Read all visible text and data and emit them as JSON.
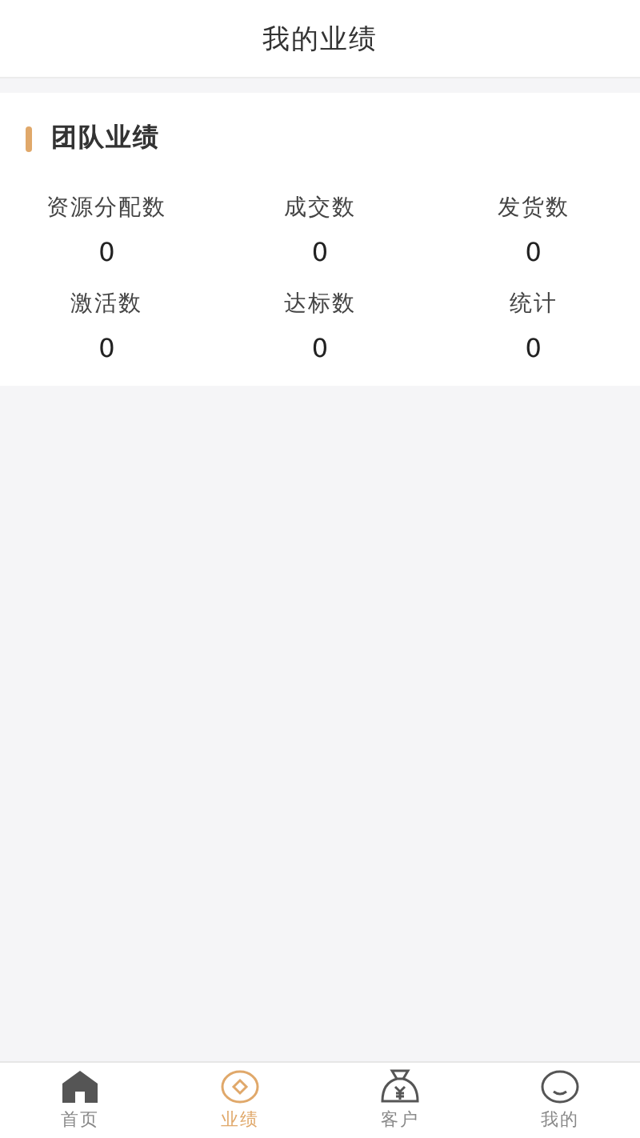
{
  "header": {
    "title": "我的业绩"
  },
  "section": {
    "title": "团队业绩"
  },
  "stats": [
    {
      "label": "资源分配数",
      "value": "0"
    },
    {
      "label": "成交数",
      "value": "0"
    },
    {
      "label": "发货数",
      "value": "0"
    },
    {
      "label": "激活数",
      "value": "0"
    },
    {
      "label": "达标数",
      "value": "0"
    },
    {
      "label": "统计",
      "value": "0"
    }
  ],
  "tab_bar": [
    {
      "label": "首页",
      "kind": "home",
      "selected": false
    },
    {
      "label": "业绩",
      "kind": "coin",
      "selected": true
    },
    {
      "label": "客户",
      "kind": "bag",
      "selected": false
    },
    {
      "label": "我的",
      "kind": "face",
      "selected": false
    }
  ]
}
